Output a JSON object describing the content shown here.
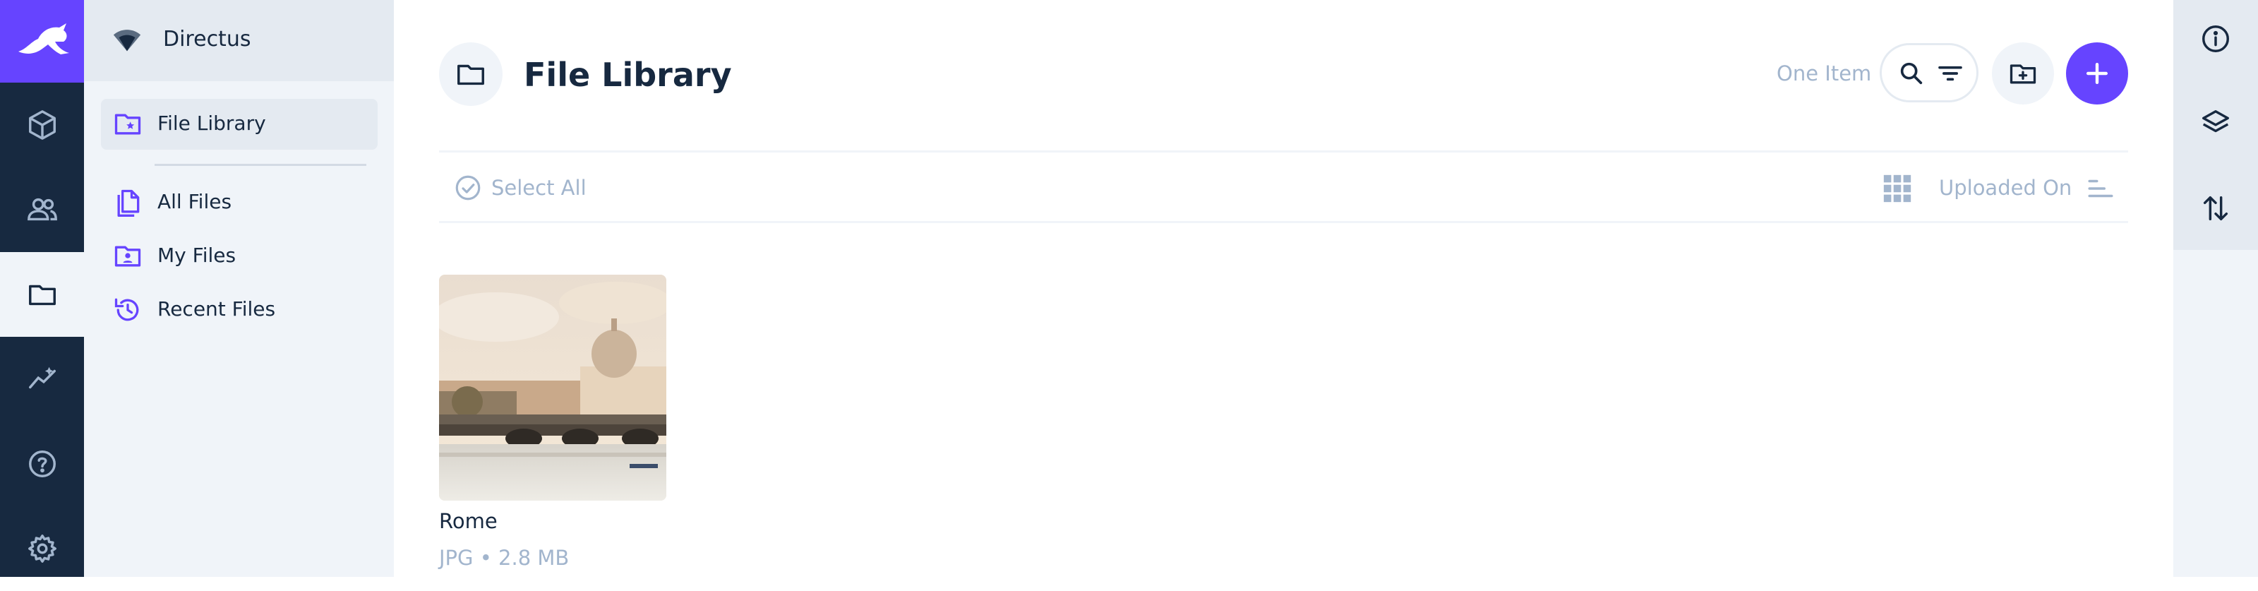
{
  "colors": {
    "accent": "#6644ff",
    "module_bar": "#172940",
    "nav_bg": "#f0f4f9",
    "muted_text": "#a2b5cd"
  },
  "module_bar": {
    "items": [
      {
        "icon": "cube-icon",
        "label": ""
      },
      {
        "icon": "users-icon",
        "label": ""
      },
      {
        "icon": "folder-icon",
        "label": "",
        "active": true
      },
      {
        "icon": "insights-icon",
        "label": ""
      },
      {
        "icon": "help-icon",
        "label": ""
      },
      {
        "icon": "gear-icon",
        "label": ""
      }
    ]
  },
  "project": {
    "name": "Directus"
  },
  "nav": {
    "items": [
      {
        "label": "File Library",
        "icon": "folder-special-icon",
        "active": true
      },
      {
        "label": "All Files",
        "icon": "files-icon"
      },
      {
        "label": "My Files",
        "icon": "folder-user-icon"
      },
      {
        "label": "Recent Files",
        "icon": "history-icon"
      }
    ]
  },
  "header": {
    "title": "File Library",
    "item_count": "One Item"
  },
  "toolbar": {
    "select_all": "Select All",
    "sort_field": "Uploaded On"
  },
  "files": [
    {
      "title": "Rome",
      "meta": "JPG • 2.8 MB"
    }
  ]
}
